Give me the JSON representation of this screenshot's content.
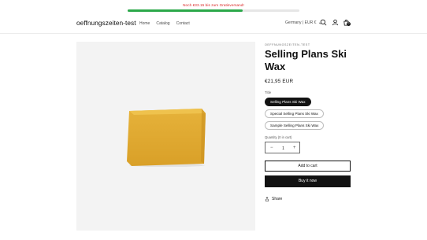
{
  "announcement": {
    "text": "Noch €33.15 bis zum Gratisversand!",
    "progress_fraction": 0.67,
    "colors": {
      "text": "#d9201e",
      "progress": "#2ba84a",
      "track": "#e6e6e6"
    }
  },
  "header": {
    "logo": "oeffnungszeiten-test",
    "nav": [
      "Home",
      "Catalog",
      "Contact"
    ],
    "locale": "Germany | EUR €",
    "cart_count": "0",
    "icons": [
      "search-icon",
      "account-icon",
      "cart-icon"
    ]
  },
  "product": {
    "vendor": "OEFFNUNGSZEITEN-TEST",
    "title": "Selling Plans Ski Wax",
    "price": "€21,95 EUR",
    "option_label": "Title",
    "options": [
      "Selling Plans Ski Wax",
      "Special Selling Plans Ski Wax",
      "Sample Selling Plans Ski Wax"
    ],
    "selected_option": "Selling Plans Ski Wax",
    "quantity_label": "Quantity (0 in cart)",
    "quantity_value": "1",
    "add_to_cart": "Add to cart",
    "buy_now": "Buy it now",
    "share": "Share"
  }
}
